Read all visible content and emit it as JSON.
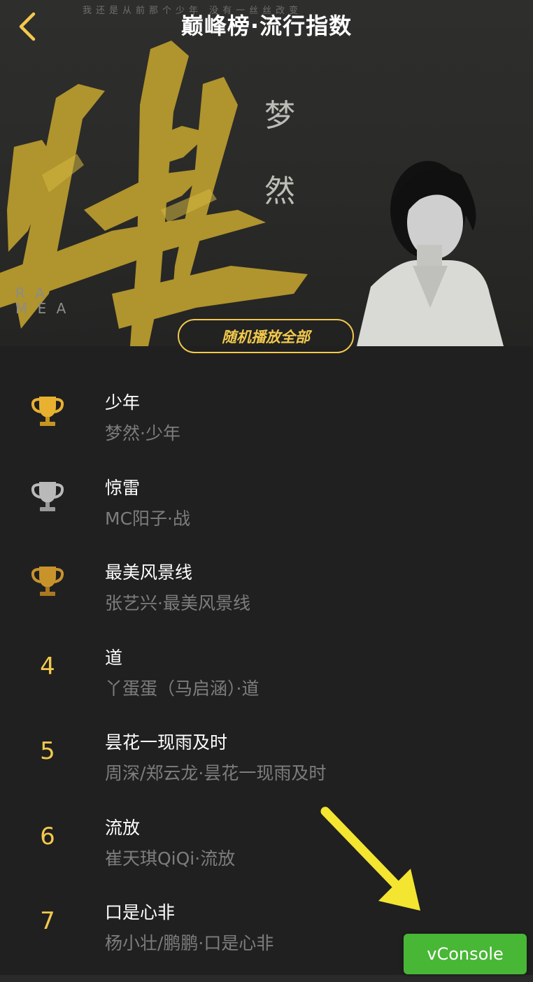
{
  "header": {
    "title": "巅峰榜·流行指数",
    "tagline": "我还是从前那个少年 没有一丝丝改变",
    "artist_vertical": "梦然",
    "english_vertical": "R A\nM E A",
    "shuffle_label": "随机播放全部"
  },
  "icons": {
    "back": "chevron-left-icon",
    "trophy": "trophy-icon"
  },
  "colors": {
    "accent": "#f2c94c",
    "gold_trophy": "#e8b130",
    "silver_trophy": "#b9b9b9",
    "vconsole": "#48b736"
  },
  "songs": [
    {
      "rank": "1",
      "rank_icon": "trophy-gold",
      "title": "少年",
      "subtitle": "梦然·少年"
    },
    {
      "rank": "2",
      "rank_icon": "trophy-silver",
      "title": "惊雷",
      "subtitle": "MC阳子·战"
    },
    {
      "rank": "3",
      "rank_icon": "trophy-bronze",
      "title": "最美风景线",
      "subtitle": "张艺兴·最美风景线"
    },
    {
      "rank": "4",
      "title": "道",
      "subtitle": "丫蛋蛋（马启涵）·道"
    },
    {
      "rank": "5",
      "title": "昙花一现雨及时",
      "subtitle": "周深/郑云龙·昙花一现雨及时"
    },
    {
      "rank": "6",
      "title": "流放",
      "subtitle": "崔天琪QiQi·流放"
    },
    {
      "rank": "7",
      "title": "口是心非",
      "subtitle": "杨小壮/鹏鹏·口是心非"
    }
  ],
  "overlay": {
    "vconsole_label": "vConsole"
  }
}
